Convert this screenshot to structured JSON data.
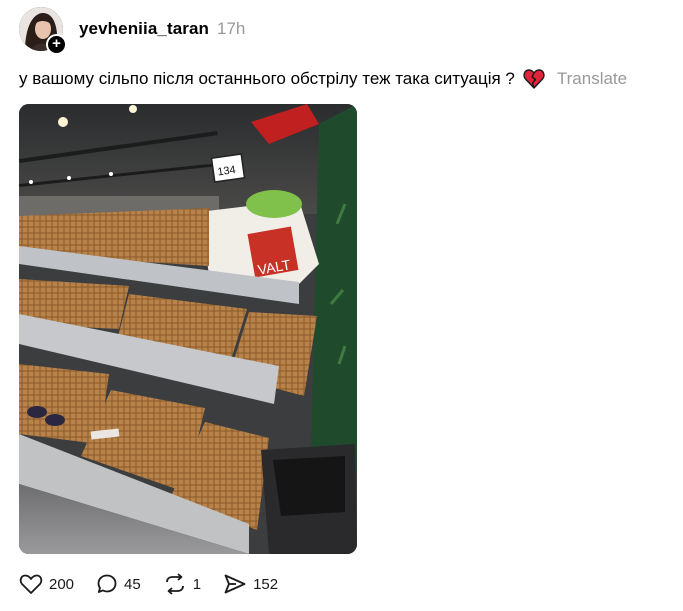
{
  "post": {
    "username": "yevheniia_taran",
    "time_ago": "17h",
    "caption": "у вашому сільпо після останнього обстрілу теж така ситуація ?",
    "caption_emoji": "broken-heart-icon",
    "translate_label": "Translate",
    "photo_price_tag": "134",
    "photo_box_text": "VALT",
    "likes": "200",
    "replies": "45",
    "reposts": "1",
    "shares": "152"
  },
  "colors": {
    "text": "#000000",
    "muted": "#999999",
    "emoji_red": "#e0243a"
  }
}
